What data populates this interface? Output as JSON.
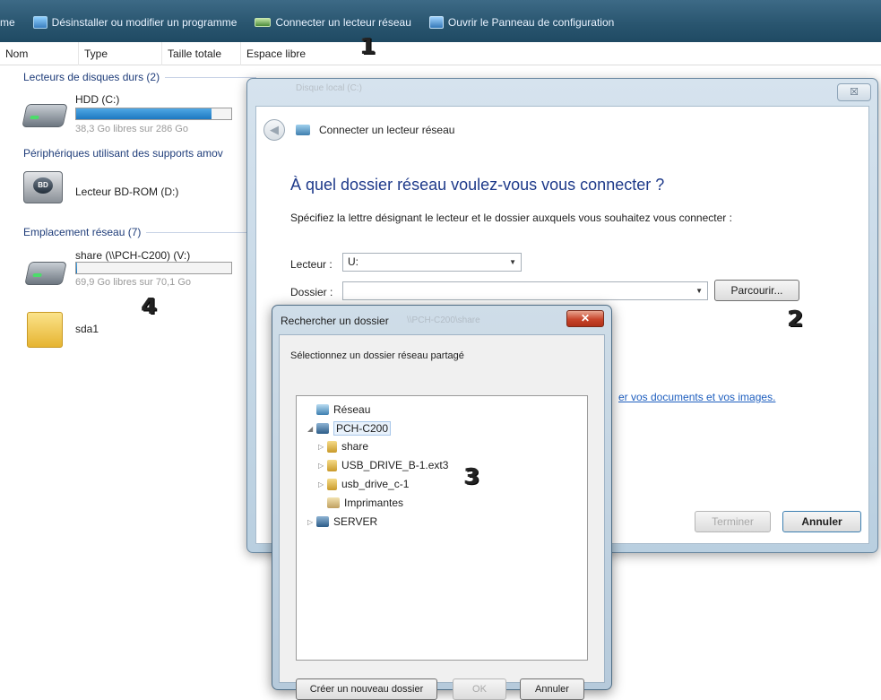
{
  "toolbar": {
    "partial_left": "me",
    "uninstall": "Désinstaller ou modifier un programme",
    "map_drive": "Connecter un lecteur réseau",
    "control_panel": "Ouvrir le Panneau de configuration"
  },
  "columns": [
    "Nom",
    "Type",
    "Taille totale",
    "Espace libre"
  ],
  "markers": {
    "m1": "1",
    "m2": "2",
    "m3": "3",
    "m4": "4"
  },
  "explorer": {
    "hard_drives_header": "Lecteurs de disques durs (2)",
    "hdd_name": "HDD (C:)",
    "hdd_space": "38,3 Go libres sur 286 Go",
    "hdd_used_fraction": 0.87,
    "removable_header": "Périphériques utilisant des supports amov",
    "bd_name": "Lecteur BD-ROM (D:)",
    "bd_icon_label": "BD",
    "network_header": "Emplacement réseau (7)",
    "share_name": "share (\\\\PCH-C200) (V:)",
    "share_space": "69,9 Go libres sur 70,1 Go",
    "share_used_fraction": 0.003,
    "sda1_name": "sda1"
  },
  "connect_dialog": {
    "close": "☒",
    "faint_path": "Disque local (C:)",
    "title": "Connecter un lecteur réseau",
    "heading": "À quel dossier réseau voulez-vous vous connecter ?",
    "instruction": "Spécifiez la lettre désignant le lecteur et le dossier auxquels vous souhaitez vous connecter :",
    "drive_label": "Lecteur :",
    "drive_value": "U:",
    "folder_label": "Dossier :",
    "folder_value": "",
    "browse_button": "Parcourir...",
    "link_text": "er vos documents et vos images.",
    "finish_button": "Terminer",
    "cancel_button": "Annuler"
  },
  "browse_dialog": {
    "title": "Rechercher un dossier",
    "faint_title": "\\\\PCH-C200\\share",
    "close": "✕",
    "description": "Sélectionnez un dossier réseau partagé",
    "tree": {
      "network": "Réseau",
      "pch": "PCH-C200",
      "share": "share",
      "usb1": "USB_DRIVE_B-1.ext3",
      "usb2": "usb_drive_c-1",
      "printers": "Imprimantes",
      "server": "SERVER"
    },
    "new_folder_button": "Créer un nouveau dossier",
    "ok_button": "OK",
    "cancel_button": "Annuler"
  }
}
